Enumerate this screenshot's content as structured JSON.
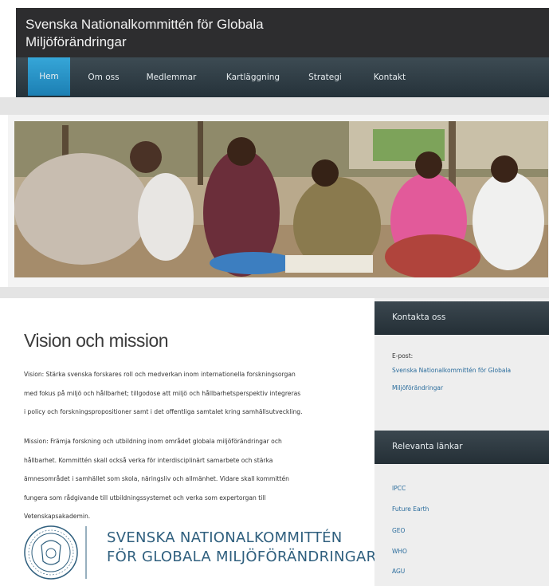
{
  "header": {
    "title_line1": "Svenska Nationalkommittén för Globala",
    "title_line2": "Miljöförändringar"
  },
  "nav": [
    {
      "label": "Hem",
      "active": true
    },
    {
      "label": "Om oss"
    },
    {
      "label": "Medlemmar"
    },
    {
      "label": "Kartläggning"
    },
    {
      "label": "Strategi"
    },
    {
      "label": "Kontakt"
    }
  ],
  "main": {
    "title": "Vision och mission",
    "vision_lines": [
      "Vision: Stärka svenska forskares roll och medverkan inom internationella forskningsorgan",
      "med fokus på miljö och hållbarhet; tillgodose att miljö och hållbarhetsperspektiv integreras",
      "i policy och forskningspropositioner samt i det offentliga samtalet kring samhällsutveckling."
    ],
    "mission_lines": [
      "Mission: Främja forskning och utbildning inom området globala miljöförändringar och",
      "hållbarhet. Kommittén skall också verka för interdisciplinärt samarbete och stärka",
      "ämnesområdet i samhället som skola, näringsliv och allmänhet. Vidare skall kommittén",
      "fungera som rådgivande till utbildningssystemet och verka som expertorgan till",
      "Vetenskapsakademin."
    ],
    "logo_line1": "SVENSKA NATIONALKOMMITTÉN",
    "logo_line2": "FÖR GLOBALA MILJÖFÖRÄNDRINGAR"
  },
  "sidebar": {
    "contact_heading": "Kontakta oss",
    "email_label": "E-post:",
    "contact_link_line1": "Svenska Nationalkommittén för Globala",
    "contact_link_line2": "Miljöförändringar",
    "links_heading": "Relevanta länkar",
    "links": [
      "IPCC",
      "Future Earth",
      "GEO",
      "WHO",
      "AGU"
    ]
  },
  "colors": {
    "header": "#2d2d2f",
    "nav": "#2f3c44",
    "active_tab": "#2a96cc",
    "link": "#2a6c9c",
    "logo": "#2f5f7e"
  }
}
